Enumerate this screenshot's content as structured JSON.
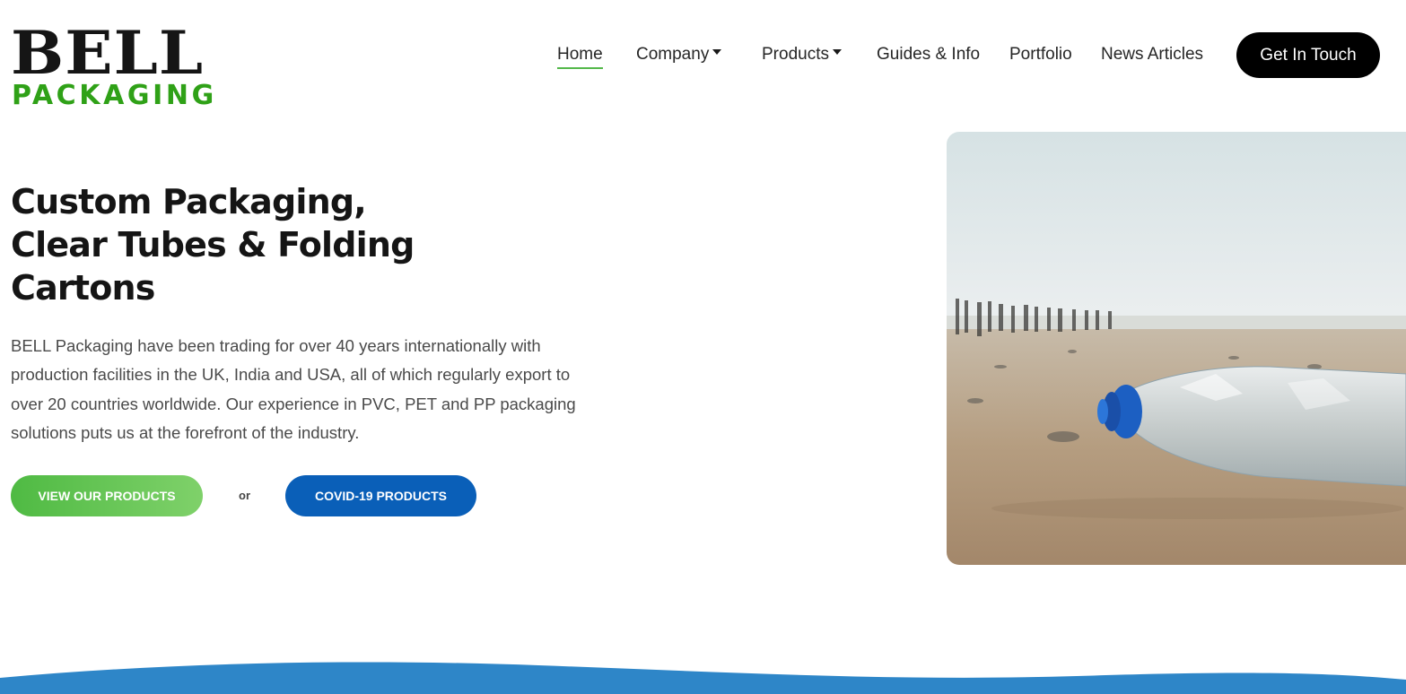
{
  "brand": {
    "name_top": "BELL",
    "name_bottom": "PACKAGING",
    "primary_color": "#151515",
    "accent_green": "#2fa117"
  },
  "nav": {
    "items": [
      {
        "label": "Home",
        "active": true,
        "dropdown": false
      },
      {
        "label": "Company",
        "active": false,
        "dropdown": true
      },
      {
        "label": "Products",
        "active": false,
        "dropdown": true
      },
      {
        "label": "Guides & Info",
        "active": false,
        "dropdown": false
      },
      {
        "label": "Portfolio",
        "active": false,
        "dropdown": false
      },
      {
        "label": "News Articles",
        "active": false,
        "dropdown": false
      }
    ],
    "cta_label": "Get In Touch"
  },
  "hero": {
    "title_lines": [
      "Custom Packaging,",
      "Clear Tubes & Folding",
      "Cartons"
    ],
    "description": "BELL Packaging have been trading for over 40 years internationally with production facilities in the UK, India and USA, all of which regularly export to over 20 countries worldwide. Our experience in PVC, PET and PP packaging solutions puts us at the forefront of the industry.",
    "primary_button": "VIEW OUR PRODUCTS",
    "separator": "or",
    "secondary_button": "COVID-19 PRODUCTS",
    "image_icon": "plastic-bottle-on-beach-photo"
  },
  "colors": {
    "button_green": "#4fba43",
    "button_blue": "#0a5fb8",
    "wave_blue": "#2e86c8",
    "active_underline": "#53b84a"
  }
}
